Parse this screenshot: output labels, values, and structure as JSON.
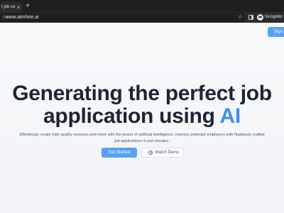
{
  "browser": {
    "tab_title": "t job co",
    "tab_close": "×",
    "new_tab": "+",
    "url_prefix": "c",
    "url": "www.aimhire.ai",
    "incognito_label": "Incognito"
  },
  "header": {
    "sign_in_label": "Sign I"
  },
  "hero": {
    "title_line1": "Generating the perfect job",
    "title_line2_prefix": "application using ",
    "title_highlight": "AI",
    "subtitle": "Effortlessly create high-quality resumes and more with the power of artificial intelligence. Impress potential employers with flawlessly crafted job applications in just minutes.",
    "primary_button": "Get Started",
    "secondary_button": "Watch Demo"
  },
  "colors": {
    "accent": "#3d8ef0",
    "button": "#5aa0f5",
    "heading": "#1d2533"
  }
}
